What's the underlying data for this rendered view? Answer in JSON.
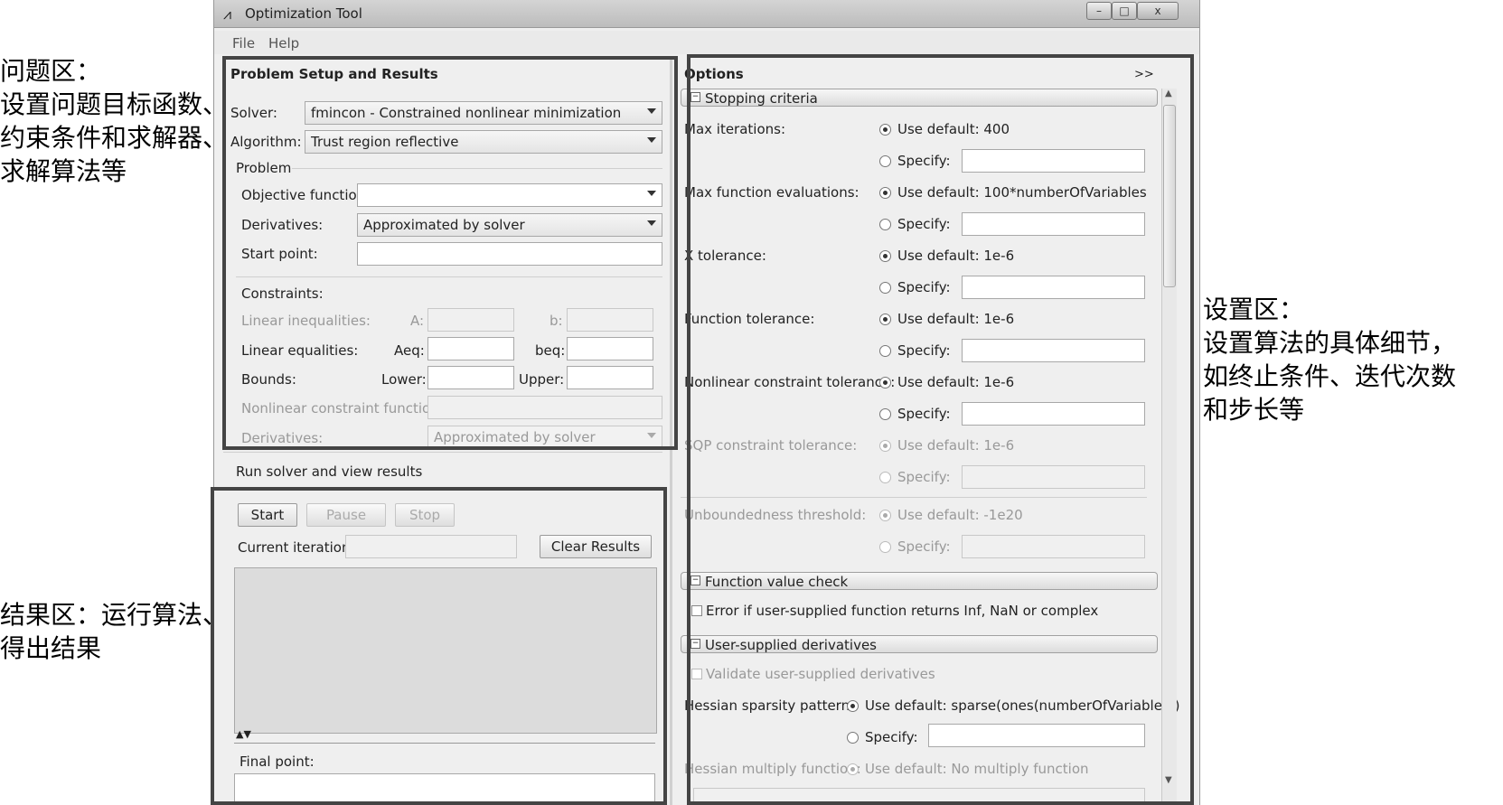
{
  "annotations": {
    "problem": {
      "lines": [
        "问题区：",
        "设置问题目标函数、",
        "约束条件和求解器、",
        "求解算法等"
      ]
    },
    "results": {
      "lines": [
        "结果区：运行算法、",
        "得出结果"
      ]
    },
    "options": {
      "lines": [
        "设置区：",
        "设置算法的具体细节，",
        "如终止条件、迭代次数",
        "和步长等"
      ]
    }
  },
  "window": {
    "title": "Optimization Tool",
    "menu": [
      "File",
      "Help"
    ],
    "controls": {
      "minimize": "–",
      "maximize": "□",
      "close": "x"
    }
  },
  "problem": {
    "header": "Problem Setup and Results",
    "solver_label": "Solver:",
    "solver_value": "fmincon - Constrained nonlinear minimization",
    "algorithm_label": "Algorithm:",
    "algorithm_value": "Trust region reflective",
    "problem_group": "Problem",
    "objective_label": "Objective function:",
    "objective_value": "",
    "derivatives_label": "Derivatives:",
    "derivatives_value": "Approximated by solver",
    "start_label": "Start point:",
    "start_value": "",
    "constraints_label": "Constraints:",
    "lin_ineq_label": "Linear inequalities:",
    "a_label": "A:",
    "b_label": "b:",
    "lin_eq_label": "Linear equalities:",
    "aeq_label": "Aeq:",
    "beq_label": "beq:",
    "bounds_label": "Bounds:",
    "lower_label": "Lower:",
    "upper_label": "Upper:",
    "nonlin_label": "Nonlinear constraint function:",
    "derivatives2_label": "Derivatives:",
    "derivatives2_value": "Approximated by solver"
  },
  "run": {
    "group": "Run solver and view results",
    "start": "Start",
    "pause": "Pause",
    "stop": "Stop",
    "current_iteration_label": "Current iteration:",
    "clear_results": "Clear Results",
    "final_point_label": "Final point:"
  },
  "options": {
    "header": "Options",
    "expand": ">>",
    "stopping_criteria": "Stopping criteria",
    "max_iter_label": "Max iterations:",
    "max_iter_default": "Use default: 400",
    "max_fev_label": "Max function evaluations:",
    "max_fev_default": "Use default: 100*numberOfVariables",
    "xtol_label": "X tolerance:",
    "xtol_default": "Use default: 1e-6",
    "ftol_label": "Function tolerance:",
    "ftol_default": "Use default: 1e-6",
    "nlctol_label": "Nonlinear constraint tolerance:",
    "nlctol_default": "Use default: 1e-6",
    "sqp_label": "SQP constraint tolerance:",
    "sqp_default": "Use default: 1e-6",
    "unb_label": "Unboundedness threshold:",
    "unb_default": "Use default: -1e20",
    "specify": "Specify:",
    "fvc_section": "Function value check",
    "fvc_check": "Error if user-supplied function returns Inf, NaN or complex",
    "usd_section": "User-supplied derivatives",
    "usd_check": "Validate user-supplied derivatives",
    "hess_label": "Hessian sparsity pattern:",
    "hess_default": "Use default: sparse(ones(numberOfVariables))",
    "hessmult_label": "Hessian multiply function:",
    "hessmult_default": "Use default: No multiply function"
  }
}
